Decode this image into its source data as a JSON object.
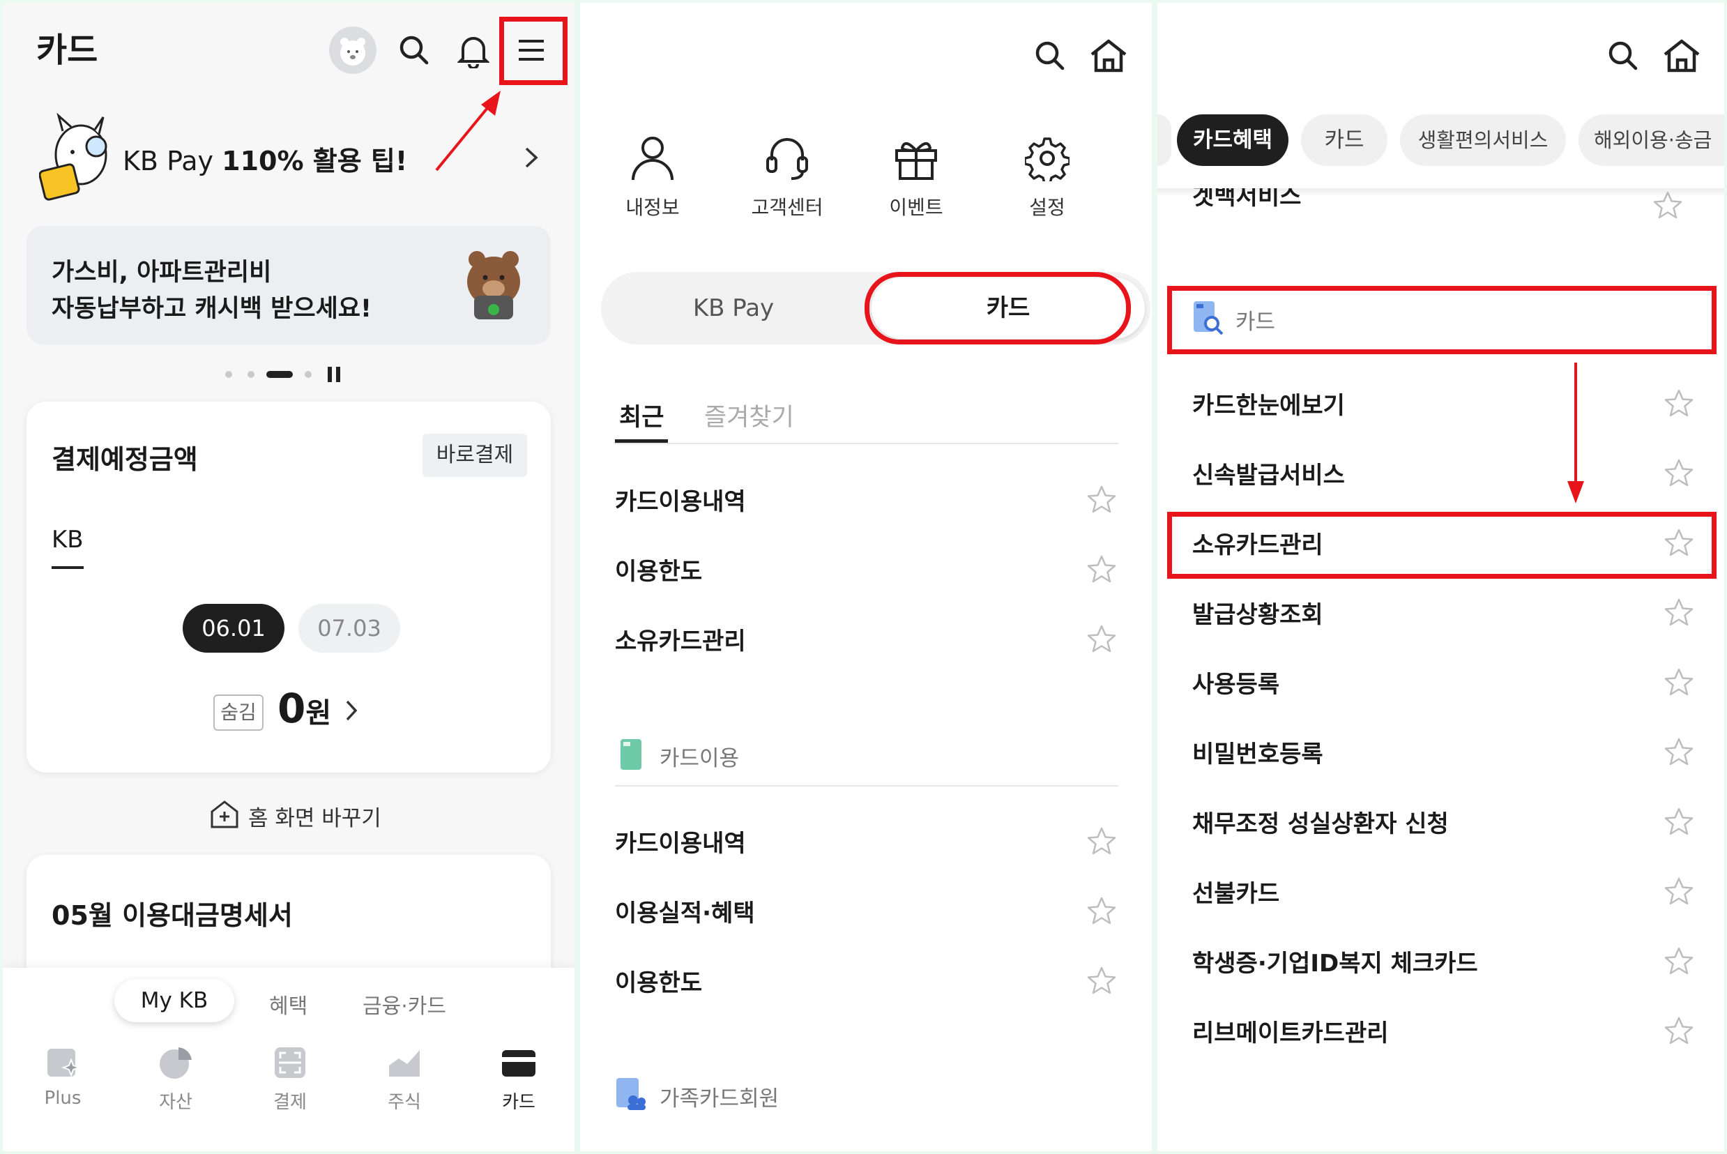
{
  "colors": {
    "accent_red": "#e8141b",
    "dark_pill": "#1f1f1f",
    "kb_gray": "#f2f2f2",
    "mint_icon": "#6fcaa8",
    "blue_icon": "#3b6fd6"
  },
  "panel1": {
    "title": "카드",
    "banner": {
      "prefix": "KB Pay ",
      "bold": "110% 활용 팁!"
    },
    "promo": {
      "line1": "가스비, 아파트관리비",
      "line2": "자동납부하고 캐시백 받으세요!"
    },
    "payment": {
      "title": "결제예정금액",
      "pay_button": "바로결제",
      "tab": "KB",
      "dates": [
        "06.01",
        "07.03"
      ],
      "hide_label": "숨김",
      "amount_num": "0",
      "amount_unit": "원"
    },
    "home_change": "홈 화면 바꾸기",
    "statement": "05월 이용대금명세서",
    "bottom_tabs": [
      "My KB",
      "혜택",
      "금융·카드"
    ],
    "bottom_nav": [
      {
        "label": "Plus",
        "icon": "plus-sparkle-icon"
      },
      {
        "label": "자산",
        "icon": "pie-chart-icon"
      },
      {
        "label": "결제",
        "icon": "scan-icon"
      },
      {
        "label": "주식",
        "icon": "stock-chart-icon"
      },
      {
        "label": "카드",
        "icon": "card-icon"
      }
    ]
  },
  "panel2": {
    "quick": [
      {
        "label": "내정보",
        "icon": "person-icon"
      },
      {
        "label": "고객센터",
        "icon": "headset-icon"
      },
      {
        "label": "이벤트",
        "icon": "gift-icon"
      },
      {
        "label": "설정",
        "icon": "gear-icon"
      }
    ],
    "segment": [
      "KB Pay",
      "카드"
    ],
    "tabs": [
      "최근",
      "즐겨찾기"
    ],
    "recent": [
      "카드이용내역",
      "이용한도",
      "소유카드관리"
    ],
    "section_card_use": "카드이용",
    "card_use_items": [
      "카드이용내역",
      "이용실적·혜택",
      "이용한도"
    ],
    "section_family": "가족카드회원"
  },
  "panel3": {
    "chips": [
      "카드혜택",
      "카드",
      "생활편의서비스",
      "해외이용·송금"
    ],
    "cut_item": "겟백서비스",
    "section": "카드",
    "items": [
      "카드한눈에보기",
      "신속발급서비스",
      "소유카드관리",
      "발급상황조회",
      "사용등록",
      "비밀번호등록",
      "채무조정 성실상환자 신청",
      "선불카드",
      "학생증·기업ID복지 체크카드",
      "리브메이트카드관리"
    ]
  }
}
